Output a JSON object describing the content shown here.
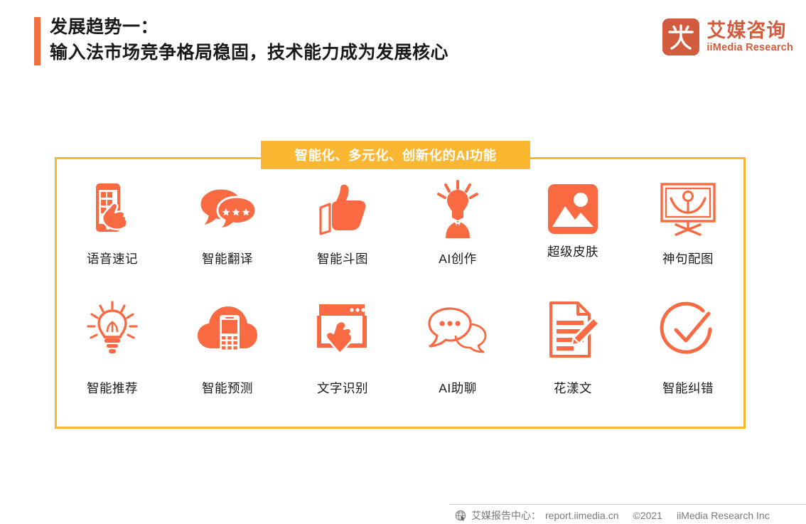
{
  "header": {
    "title_line1": "发展趋势一：",
    "title_line2": "输入法市场竞争格局稳固，技术能力成为发展核心",
    "accent_color": "#F2703F"
  },
  "logo": {
    "mark_char": "艾",
    "name_cn": "艾媒咨询",
    "name_en": "iiMedia Research",
    "color": "#D35C3E"
  },
  "panel": {
    "banner_label": "智能化、多元化、创新化的AI功能",
    "banner_color": "#FBB732",
    "border_color": "#F8B62D",
    "icon_color": "#F96A42"
  },
  "features": [
    {
      "label": "语音速记",
      "icon": "phone-hand-icon"
    },
    {
      "label": "智能翻译",
      "icon": "chat-bubbles-stars-icon"
    },
    {
      "label": "智能斗图",
      "icon": "thumbs-up-icon"
    },
    {
      "label": "AI创作",
      "icon": "person-lightbulb-icon"
    },
    {
      "label": "超级皮肤",
      "icon": "image-picture-icon"
    },
    {
      "label": "神句配图",
      "icon": "framed-photo-person-icon"
    },
    {
      "label": "智能推荐",
      "icon": "lightbulb-rays-icon"
    },
    {
      "label": "智能预测",
      "icon": "cloud-phone-icon"
    },
    {
      "label": "文字识别",
      "icon": "browser-hand-cursor-icon"
    },
    {
      "label": "AI助聊",
      "icon": "chat-bubbles-outline-icon"
    },
    {
      "label": "花漾文",
      "icon": "document-pencil-icon"
    },
    {
      "label": "智能纠错",
      "icon": "check-circle-icon"
    }
  ],
  "footer": {
    "source_label": "艾媒报告中心：",
    "url": "report.iimedia.cn",
    "copyright": "©2021",
    "company": "iiMedia Research  Inc"
  }
}
